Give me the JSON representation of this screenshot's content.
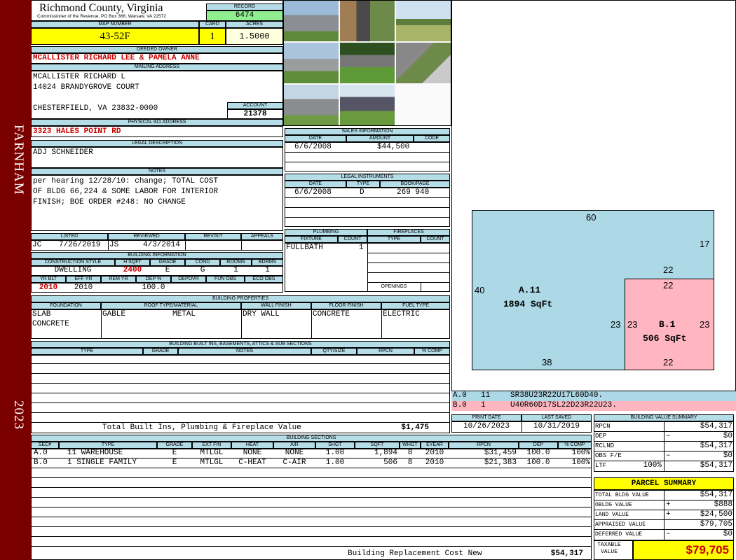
{
  "side": {
    "town": "FARNHAM",
    "year": "2023"
  },
  "header": {
    "county": "Richmond County, Virginia",
    "commissioner": "Commissioner of the Revenue, PO Box 366, Warsaw, VA 22572",
    "record_label": "RECORD",
    "record": "6474",
    "map_label": "MAP NUMBER",
    "map": "43-52F",
    "card_label": "CARD",
    "card": "1",
    "acres_label": "ACRES",
    "acres": "1.5000"
  },
  "owner": {
    "label": "DEEDED OWNER",
    "name": "MCALLISTER RICHARD LEE & PAMELA ANNE",
    "mail_label": "MAILING ADDRESS",
    "mail": [
      "MCALLISTER RICHARD L",
      "14024 BRANDYGROVE COURT",
      "",
      "CHESTERFIELD, VA 23832-0000"
    ],
    "account_label": "ACCOUNT",
    "account": "21378",
    "addr_label": "PHYSICAL 911 ADDRESS",
    "addr": "3323 HALES POINT RD"
  },
  "legal": {
    "label": "LEGAL DESCRIPTION",
    "text": "ADJ SCHNEIDER"
  },
  "notes": {
    "label": "NOTES",
    "lines": [
      "per hearing 12/28/10: change; TOTAL COST",
      "OF BLDG 66,224 & SOME LABOR FOR INTERIOR",
      "FINISH; BOE ORDER #248: NO CHANGE"
    ]
  },
  "review": {
    "listed_label": "LISTED",
    "listed_by": "JC",
    "listed": "7/26/2019",
    "reviewed_label": "REVIEWED",
    "reviewed_by": "JS",
    "reviewed": "4/3/2014",
    "revisit_label": "REVISIT",
    "appeals_label": "APPEALS"
  },
  "bldg": {
    "label": "BUILDING INFORMATION",
    "cols": [
      "CONSTRUCTION STYLE",
      "H SQFT",
      "GRADE",
      "COND",
      "ROOMS",
      "BDRMS"
    ],
    "vals": [
      "DWELLING",
      "2400",
      "E",
      "G",
      "1",
      "1"
    ],
    "cols2": [
      "YR BLT",
      "EFF YR",
      "REM YR",
      "DEP %",
      "DEPOVR",
      "FUN OBS",
      "ECO OBS"
    ],
    "vals2": [
      "2010",
      "2010",
      "",
      "100.0",
      "",
      "",
      ""
    ]
  },
  "props": {
    "label": "BUILDING PROPERTIES",
    "cols": [
      "FOUNDATION",
      "ROOF TYPE/MATERIAL",
      "WALL FINISH",
      "FLOOR FINISH",
      "FUEL TYPE"
    ],
    "foundation": [
      "SLAB",
      "CONCRETE"
    ],
    "roof_type": "GABLE",
    "roof_mat": "METAL",
    "wall": "DRY WALL",
    "floor": "CONCRETE",
    "fuel": "ELECTRIC"
  },
  "builtins": {
    "label": "BUILDING BUILT INS, BASEMENTS, ATTICS & SUB SECTIONS",
    "cols": [
      "TYPE",
      "GRADE",
      "NOTES",
      "QTY/SIZE",
      "RPCN",
      "% COMP"
    ],
    "total_label": "Total Built Ins, Plumbing & Fireplace Value",
    "total": "$1,475"
  },
  "sales": {
    "label": "SALES INFORMATION",
    "cols": [
      "DATE",
      "AMOUNT",
      "CODE"
    ],
    "date": "6/6/2008",
    "amount": "$44,500"
  },
  "instr": {
    "label": "LEGAL INSTRUMENTS",
    "cols": [
      "DATE",
      "TYPE",
      "BOOK/PAGE"
    ],
    "date": "6/6/2008",
    "type": "D",
    "book": "269 940"
  },
  "plumb": {
    "label": "PLUMBING",
    "cols": [
      "FIXTURE",
      "COUNT"
    ],
    "fixture": "FULLBATH",
    "count": "1",
    "fire_label": "FIREPLACES",
    "fire_cols": [
      "TYPE",
      "COUNT"
    ],
    "openings": "OPENINGS"
  },
  "sketch": {
    "top": "60",
    "right_upper": "17",
    "mid": "22",
    "left": "40",
    "bottom_a": "38",
    "a_name": "A.11",
    "a_area": "1894 SqFt",
    "b_top": "22",
    "b_left_out": "23",
    "b_left": "23",
    "b_right": "23",
    "b_bottom": "22",
    "b_name": "B.1",
    "b_area": "506 SqFt"
  },
  "codes": [
    {
      "sec": "A.0",
      "n": "11",
      "code": "SR38U23R22U17L60D40.",
      "color": "#add8e6"
    },
    {
      "sec": "B.0",
      "n": "1",
      "code": "U40R60D17SL22D23R22U23.",
      "color": "#ffb6c1"
    }
  ],
  "dates": {
    "print_label": "PRINT DATE",
    "print": "10/26/2023",
    "saved_label": "LAST SAVED",
    "saved": "10/31/2019"
  },
  "sections": {
    "label": "BUILDING SECTIONS",
    "cols": [
      "SEC#",
      "TYPE",
      "GRADE",
      "EXT FIN",
      "HEAT",
      "AIR",
      "SHGT",
      "SQFT",
      "WHGT",
      "EYEAR",
      "RPCN",
      "DEP",
      "% COMP"
    ],
    "rows": [
      [
        "A.0",
        "11 WAREHOUSE",
        "E",
        "MTLGL",
        "NONE",
        "NONE",
        "1.00",
        "1,894",
        "8",
        "2010",
        "$31,459",
        "100.0",
        "100%"
      ],
      [
        "B.0",
        "1 SINGLE FAMILY",
        "E",
        "MTLGL",
        "C-HEAT",
        "C-AIR",
        "1.00",
        "506",
        "8",
        "2010",
        "$21,383",
        "100.0",
        "100%"
      ]
    ],
    "cost_label": "Building Replacement Cost New",
    "cost": "$54,317"
  },
  "bvs": {
    "label": "BUILDING VALUE SUMMARY",
    "rows": [
      [
        "RPCN",
        "",
        "$54,317"
      ],
      [
        "DEP",
        "–",
        "$0"
      ],
      [
        "RCLND",
        "",
        "$54,317"
      ],
      [
        "OBS F/E",
        "–",
        "$0"
      ],
      [
        "LTF",
        "100%",
        "$54,317"
      ]
    ]
  },
  "parcel": {
    "label": "PARCEL SUMMARY",
    "rows": [
      [
        "TOTAL BLDG VALUE",
        "",
        "$54,317"
      ],
      [
        "OBLDG VALUE",
        "+",
        "$888"
      ],
      [
        "LAND VALUE",
        "+",
        "$24,500"
      ],
      [
        "APPRAISED VALUE",
        "",
        "$79,705"
      ],
      [
        "DEFERRED VALUE",
        "–",
        "$0"
      ]
    ],
    "taxable_label": "TAXABLE VALUE",
    "taxable": "$79,705"
  }
}
